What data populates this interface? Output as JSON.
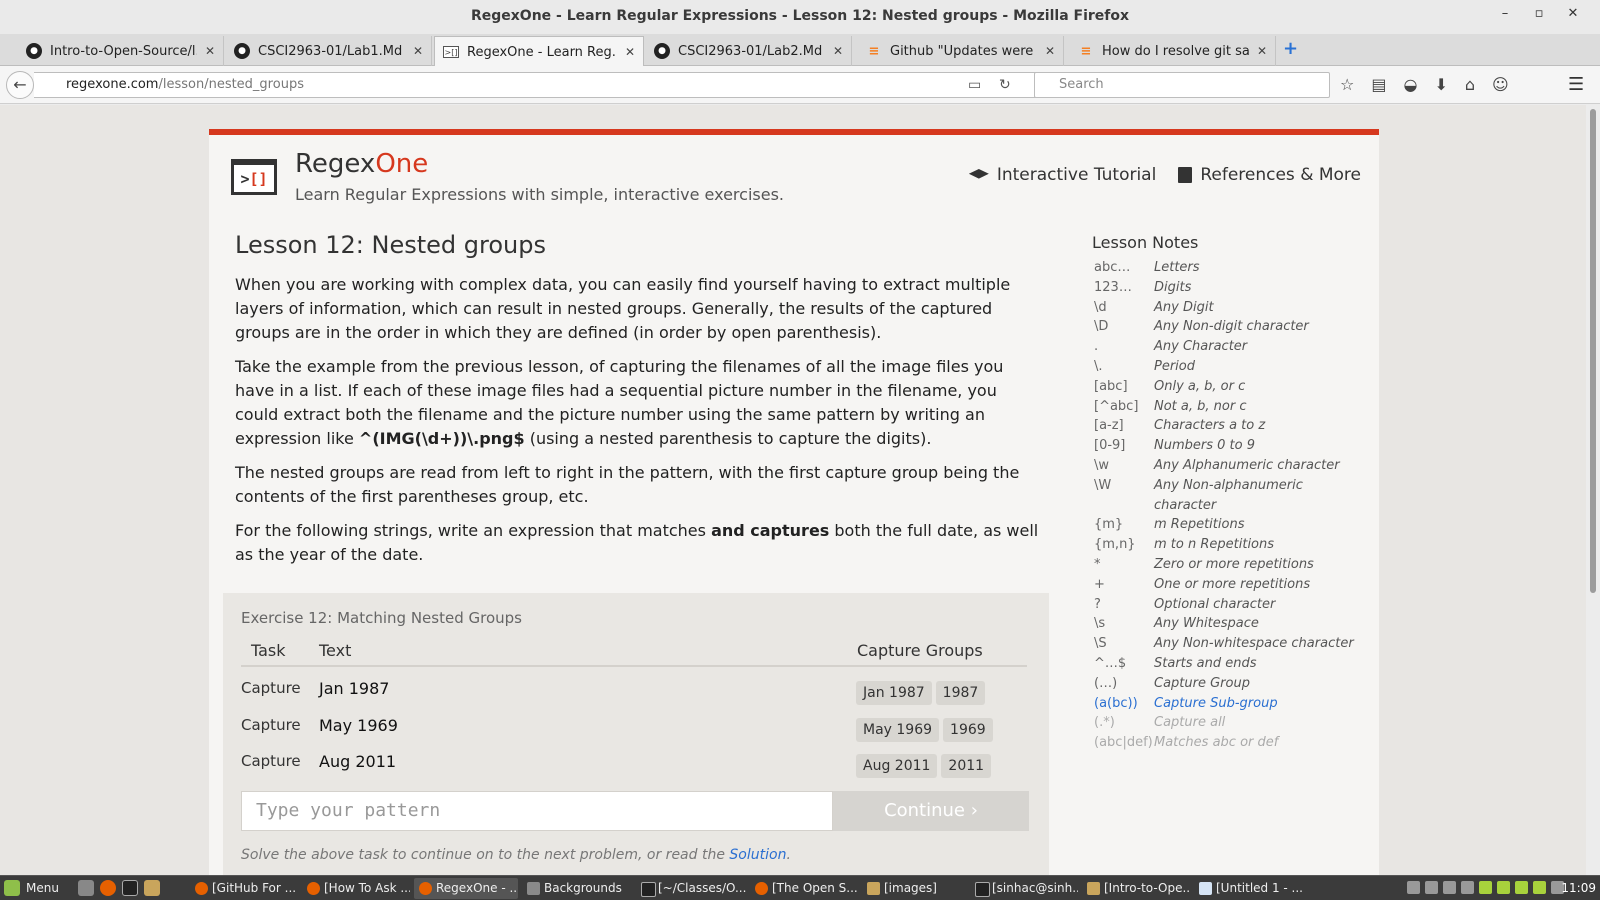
{
  "window": {
    "title": "RegexOne - Learn Regular Expressions - Lesson 12: Nested groups - Mozilla Firefox"
  },
  "tabs": [
    {
      "label": "Intro-to-Open-Source/l...",
      "icon": "github-icon"
    },
    {
      "label": "CSCI2963-01/Lab1.Md ...",
      "icon": "github-icon"
    },
    {
      "label": "RegexOne - Learn Reg...",
      "icon": "regexone-icon",
      "active": true
    },
    {
      "label": "CSCI2963-01/Lab2.Md ...",
      "icon": "github-icon"
    },
    {
      "label": "Github \"Updates were ...",
      "icon": "stackoverflow-icon"
    },
    {
      "label": "How do I resolve git sa...",
      "icon": "stackoverflow-icon"
    }
  ],
  "nav": {
    "url_host": "regexone.com",
    "url_path": "/lesson/nested_groups",
    "search_placeholder": "Search"
  },
  "site": {
    "brand_main": "Regex",
    "brand_accent": "One",
    "tagline": "Learn Regular Expressions with simple, interactive exercises.",
    "nav_tutorial": "Interactive Tutorial",
    "nav_references": "References & More",
    "accent_color": "#d6381e"
  },
  "lesson": {
    "title": "Lesson 12: Nested groups",
    "p1": "When you are working with complex data, you can easily find yourself having to extract multiple layers of information, which can result in nested groups. Generally, the results of the captured groups are in the order in which they are defined (in order by open parenthesis).",
    "p2_a": "Take the example from the previous lesson, of capturing the filenames of all the image files you have in a list. If each of these image files had a sequential picture number in the filename, you could extract both the filename and the picture number using the same pattern by writing an expression like ",
    "p2_code": "^(IMG(\\d+))\\.png$",
    "p2_b": " (using a nested parenthesis to capture the digits).",
    "p3": "The nested groups are read from left to right in the pattern, with the first capture group being the contents of the first parentheses group, etc.",
    "p4_a": "For the following strings, write an expression that matches ",
    "p4_bold": "and captures",
    "p4_b": " both the full date, as well as the year of the date."
  },
  "exercise": {
    "title": "Exercise 12: Matching Nested Groups",
    "col_task": "Task",
    "col_text": "Text",
    "col_caps": "Capture Groups",
    "rows": [
      {
        "task": "Capture",
        "text": "Jan 1987",
        "g1": "Jan 1987",
        "g2": "1987"
      },
      {
        "task": "Capture",
        "text": "May 1969",
        "g1": "May 1969",
        "g2": "1969"
      },
      {
        "task": "Capture",
        "text": "Aug 2011",
        "g1": "Aug 2011",
        "g2": "2011"
      }
    ],
    "input_placeholder": "Type your pattern",
    "continue_label": "Continue ›",
    "note_prefix": "Solve the above task to continue on to the next problem, or read the ",
    "note_link": "Solution",
    "note_suffix": "."
  },
  "notes": {
    "title": "Lesson Notes",
    "items": [
      {
        "k": "abc…",
        "v": "Letters"
      },
      {
        "k": "123…",
        "v": "Digits"
      },
      {
        "k": "\\d",
        "v": "Any Digit"
      },
      {
        "k": "\\D",
        "v": "Any Non-digit character"
      },
      {
        "k": ".",
        "v": "Any Character"
      },
      {
        "k": "\\.",
        "v": "Period"
      },
      {
        "k": "[abc]",
        "v": "Only a, b, or c"
      },
      {
        "k": "[^abc]",
        "v": "Not a, b, nor c"
      },
      {
        "k": "[a-z]",
        "v": "Characters a to z"
      },
      {
        "k": "[0-9]",
        "v": "Numbers 0 to 9"
      },
      {
        "k": "\\w",
        "v": "Any Alphanumeric character"
      },
      {
        "k": "\\W",
        "v": "Any Non-alphanumeric"
      },
      {
        "k": "",
        "v": "character"
      },
      {
        "k": "{m}",
        "v": "m Repetitions"
      },
      {
        "k": "{m,n}",
        "v": "m to n Repetitions"
      },
      {
        "k": "*",
        "v": "Zero or more repetitions"
      },
      {
        "k": "+",
        "v": "One or more repetitions"
      },
      {
        "k": "?",
        "v": "Optional character"
      },
      {
        "k": "\\s",
        "v": "Any Whitespace"
      },
      {
        "k": "\\S",
        "v": "Any Non-whitespace character"
      },
      {
        "k": "^…$",
        "v": "Starts and ends"
      },
      {
        "k": "(…)",
        "v": "Capture Group"
      },
      {
        "k": "(a(bc))",
        "v": "Capture Sub-group",
        "style": "hl"
      },
      {
        "k": "(.*)",
        "v": "Capture all",
        "style": "dim"
      },
      {
        "k": "(abc|def)",
        "v": "Matches abc or def",
        "style": "dim"
      }
    ]
  },
  "taskbar": {
    "menu_label": "Menu",
    "items": [
      {
        "label": "[GitHub For ...",
        "kind": "firefox"
      },
      {
        "label": "[How To Ask ...",
        "kind": "firefox"
      },
      {
        "label": "RegexOne - ...",
        "kind": "firefox",
        "active": true
      },
      {
        "label": "Backgrounds",
        "kind": "tool"
      },
      {
        "label": "[~/Classes/O...",
        "kind": "term"
      },
      {
        "label": "[The Open S...",
        "kind": "firefox"
      },
      {
        "label": "[images]",
        "kind": "folder"
      },
      {
        "label": "[sinhac@sinh...",
        "kind": "term"
      },
      {
        "label": "[Intro-to-Ope...",
        "kind": "folder"
      },
      {
        "label": "[Untitled 1 - ...",
        "kind": "doc"
      }
    ],
    "clock": "11:09"
  }
}
